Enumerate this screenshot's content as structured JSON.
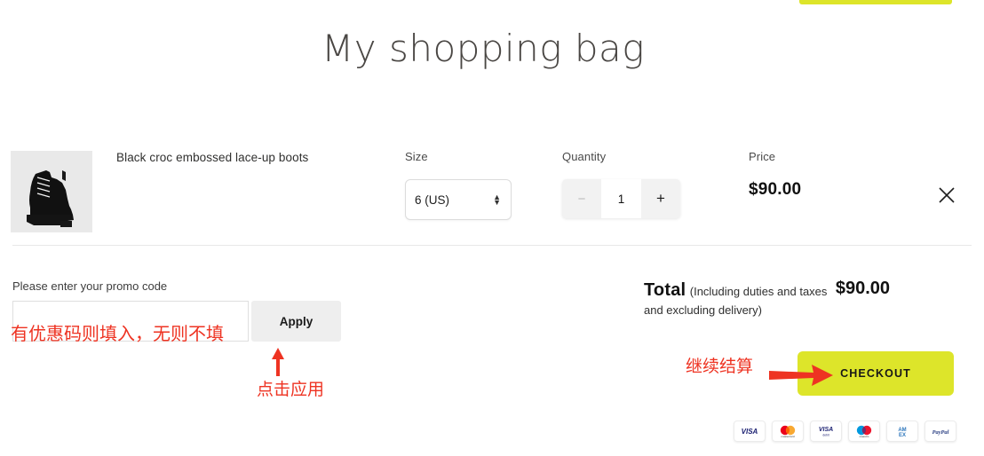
{
  "page": {
    "title": "My shopping bag"
  },
  "columns": {
    "size_label": "Size",
    "quantity_label": "Quantity",
    "price_label": "Price"
  },
  "product": {
    "name": "Black croc embossed lace-up boots",
    "size_value": "6 (US)",
    "quantity_value": "1",
    "quantity_decrement": "−",
    "quantity_increment": "+",
    "price": "$90.00",
    "remove_icon": "close-icon"
  },
  "promo": {
    "label": "Please enter your promo code",
    "input_value": "",
    "placeholder": "",
    "apply_label": "Apply"
  },
  "totals": {
    "label": "Total",
    "note_line1": "(Including duties and taxes",
    "note_line2": "and excluding delivery)",
    "amount": "$90.00"
  },
  "checkout": {
    "label": "CHECKOUT",
    "color": "#dde52a"
  },
  "payment_methods": [
    {
      "name": "visa",
      "text": "VISA"
    },
    {
      "name": "mastercard",
      "text": ""
    },
    {
      "name": "visa-debit",
      "text": "VISA"
    },
    {
      "name": "maestro",
      "text": ""
    },
    {
      "name": "amex",
      "text": "AMEX"
    },
    {
      "name": "paypal",
      "text": "PayPal"
    }
  ],
  "annotations": {
    "color": "#ee3322",
    "promo_note": "有优惠码则填入，无则不填",
    "apply_note": "点击应用",
    "checkout_note": "继续结算"
  }
}
